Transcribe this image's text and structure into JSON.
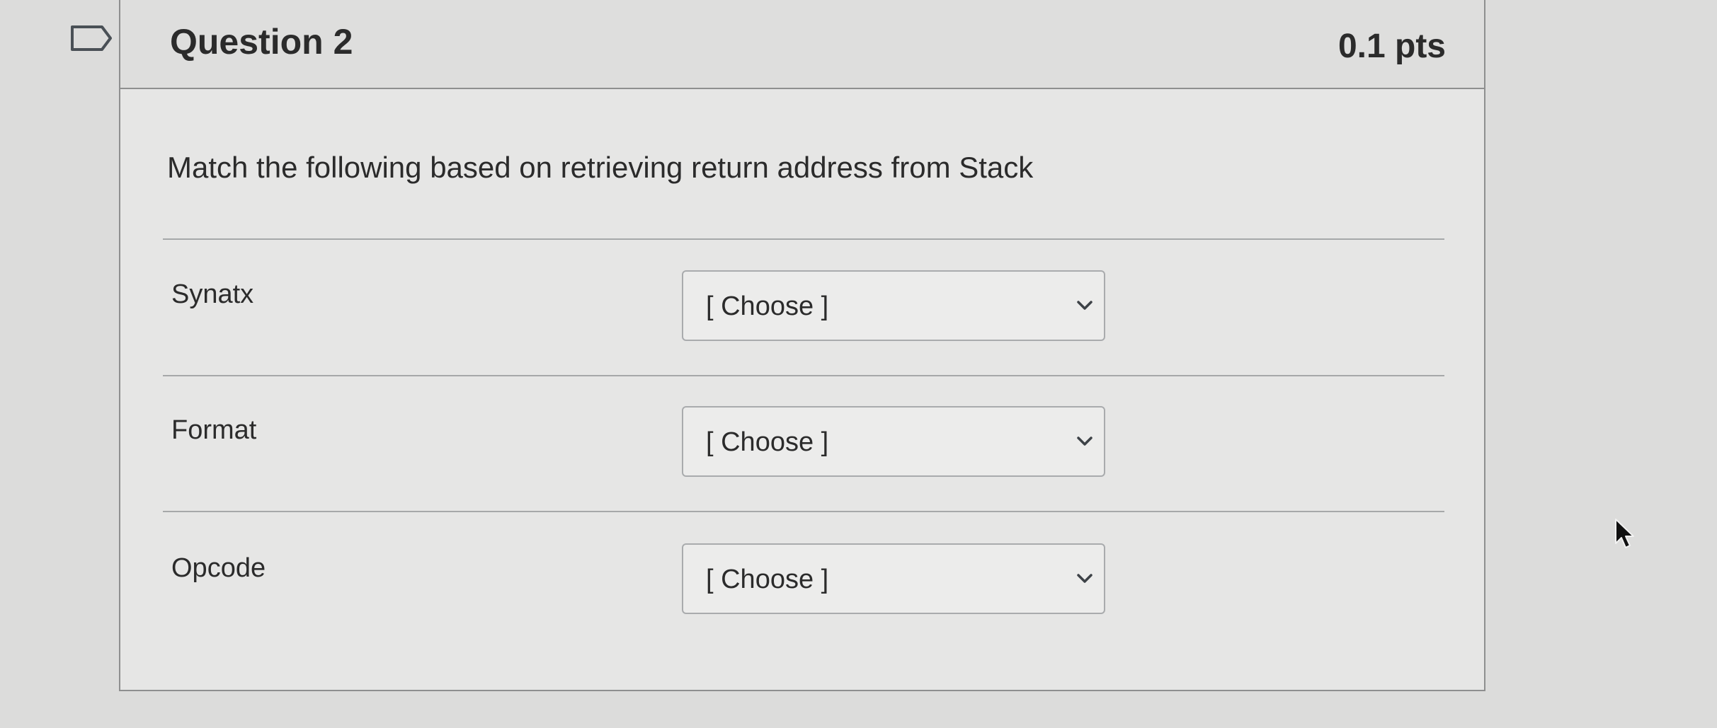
{
  "question": {
    "title": "Question 2",
    "points": "0.1 pts",
    "text": "Match the following based on retrieving return address from Stack"
  },
  "matches": [
    {
      "label": "Synatx",
      "selected": "[ Choose ]"
    },
    {
      "label": "Format",
      "selected": "[ Choose ]"
    },
    {
      "label": "Opcode",
      "selected": "[ Choose ]"
    }
  ],
  "icons": {
    "flag": "flag-icon",
    "dropdown": "chevron-down-icon",
    "cursor": "mouse-pointer-icon"
  },
  "colors": {
    "page_background": "#dcdcdb",
    "card_background": "#e6e6e5",
    "border": "#8e8f8f",
    "text": "#2b2b2b"
  }
}
